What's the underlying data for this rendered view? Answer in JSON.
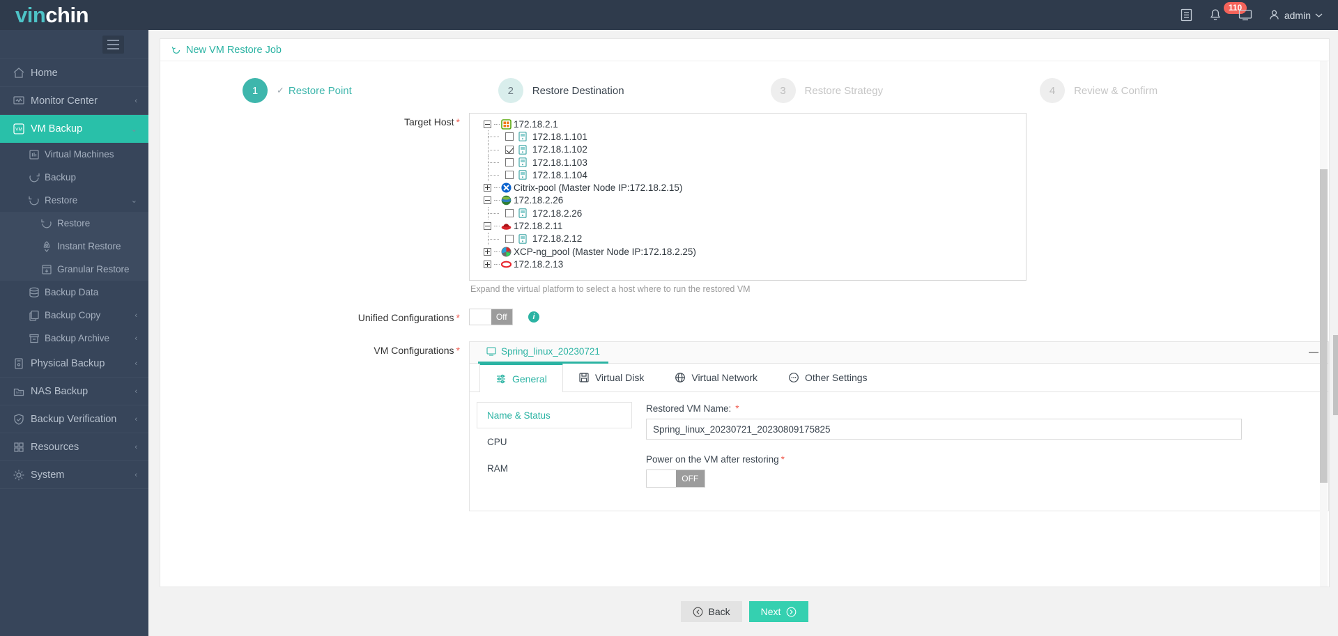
{
  "brand": {
    "part1": "vin",
    "part2": "chin"
  },
  "topbar": {
    "notifications_count": "110",
    "user_name": "admin",
    "log_icon": "list-icon",
    "bell_icon": "bell-icon",
    "monitor_icon": "monitor-icon",
    "user_icon": "user-icon",
    "caret_icon": "chevron-down-icon"
  },
  "sidebar": {
    "toggle_icon": "hamburger-icon",
    "items": [
      {
        "label": "Home",
        "icon": "home-icon",
        "level": 1,
        "active": false,
        "chevron": ""
      },
      {
        "label": "Monitor Center",
        "icon": "monitor-chart-icon",
        "level": 1,
        "active": false,
        "chevron": "‹"
      },
      {
        "label": "VM Backup",
        "icon": "vm-icon",
        "level": 1,
        "active": true,
        "chevron": "⌄"
      },
      {
        "label": "Virtual Machines",
        "icon": "machines-icon",
        "level": 2,
        "active": false,
        "chevron": ""
      },
      {
        "label": "Backup",
        "icon": "backup-icon",
        "level": 2,
        "active": false,
        "chevron": ""
      },
      {
        "label": "Restore",
        "icon": "restore-icon",
        "level": 2,
        "active": false,
        "chevron": "⌄"
      },
      {
        "label": "Restore",
        "icon": "restore-icon",
        "level": 3,
        "active": false,
        "chevron": ""
      },
      {
        "label": "Instant Restore",
        "icon": "rocket-icon",
        "level": 3,
        "active": false,
        "chevron": ""
      },
      {
        "label": "Granular Restore",
        "icon": "granular-icon",
        "level": 3,
        "active": false,
        "chevron": ""
      },
      {
        "label": "Backup Data",
        "icon": "database-icon",
        "level": 2,
        "active": false,
        "chevron": ""
      },
      {
        "label": "Backup Copy",
        "icon": "copy-icon",
        "level": 2,
        "active": false,
        "chevron": "‹"
      },
      {
        "label": "Backup Archive",
        "icon": "archive-icon",
        "level": 2,
        "active": false,
        "chevron": "‹"
      },
      {
        "label": "Physical Backup",
        "icon": "server-icon",
        "level": 1,
        "active": false,
        "chevron": "‹"
      },
      {
        "label": "NAS Backup",
        "icon": "nas-icon",
        "level": 1,
        "active": false,
        "chevron": "‹"
      },
      {
        "label": "Backup Verification",
        "icon": "shield-check-icon",
        "level": 1,
        "active": false,
        "chevron": "‹"
      },
      {
        "label": "Resources",
        "icon": "grid-icon",
        "level": 1,
        "active": false,
        "chevron": "‹"
      },
      {
        "label": "System",
        "icon": "gear-icon",
        "level": 1,
        "active": false,
        "chevron": "‹"
      }
    ]
  },
  "page": {
    "title": "New VM Restore Job",
    "title_icon": "restore-icon"
  },
  "stepper": {
    "steps": [
      {
        "num": "1",
        "label": "Restore Point",
        "state": "done",
        "check": "✓"
      },
      {
        "num": "2",
        "label": "Restore Destination",
        "state": "cur",
        "check": ""
      },
      {
        "num": "3",
        "label": "Restore Strategy",
        "state": "off",
        "check": ""
      },
      {
        "num": "4",
        "label": "Review & Confirm",
        "state": "off",
        "check": ""
      }
    ]
  },
  "form": {
    "target_host_label": "Target Host",
    "target_host_hint": "Expand the virtual platform to select a host where to run the restored VM",
    "unified_config_label": "Unified Configurations",
    "unified_config_value": "Off",
    "vm_config_label": "VM Configurations",
    "tree": [
      {
        "text": "172.18.2.1",
        "level": 1,
        "expander": "minus",
        "platform_icon": "vmware-green-icon",
        "checkbox": null
      },
      {
        "text": "172.18.1.101",
        "level": 2,
        "expander": null,
        "platform_icon": "host-icon",
        "checkbox": "unchecked"
      },
      {
        "text": "172.18.1.102",
        "level": 2,
        "expander": null,
        "platform_icon": "host-icon",
        "checkbox": "checked"
      },
      {
        "text": "172.18.1.103",
        "level": 2,
        "expander": null,
        "platform_icon": "host-icon",
        "checkbox": "unchecked"
      },
      {
        "text": "172.18.1.104",
        "level": 2,
        "expander": null,
        "platform_icon": "host-icon",
        "checkbox": "unchecked"
      },
      {
        "text": "Citrix-pool (Master Node IP:172.18.2.15)",
        "level": 1,
        "expander": "plus",
        "platform_icon": "citrix-icon",
        "checkbox": null
      },
      {
        "text": "172.18.2.26",
        "level": 1,
        "expander": "minus",
        "platform_icon": "globe-icon",
        "checkbox": null
      },
      {
        "text": "172.18.2.26",
        "level": 2,
        "expander": null,
        "platform_icon": "host-icon",
        "checkbox": "unchecked"
      },
      {
        "text": "172.18.2.11",
        "level": 1,
        "expander": "minus",
        "platform_icon": "redhat-icon",
        "checkbox": null
      },
      {
        "text": "172.18.2.12",
        "level": 2,
        "expander": null,
        "platform_icon": "host-icon",
        "checkbox": "unchecked"
      },
      {
        "text": "XCP-ng_pool (Master Node IP:172.18.2.25)",
        "level": 1,
        "expander": "plus",
        "platform_icon": "xcpng-icon",
        "checkbox": null
      },
      {
        "text": "172.18.2.13",
        "level": 1,
        "expander": "plus",
        "platform_icon": "oracle-icon",
        "checkbox": null
      }
    ]
  },
  "vmpanel": {
    "vm_tab_label": "Spring_linux_20230721",
    "vm_tab_icon": "vm-screen-icon",
    "collapse_icon": "minimize-icon",
    "tabs": [
      {
        "label": "General",
        "icon": "sliders-icon",
        "active": true
      },
      {
        "label": "Virtual Disk",
        "icon": "disk-icon",
        "active": false
      },
      {
        "label": "Virtual Network",
        "icon": "globe-icon",
        "active": false
      },
      {
        "label": "Other Settings",
        "icon": "dots-circle-icon",
        "active": false
      }
    ],
    "subnav": [
      {
        "label": "Name & Status",
        "active": true
      },
      {
        "label": "CPU",
        "active": false
      },
      {
        "label": "RAM",
        "active": false
      }
    ],
    "restored_vm_name_label": "Restored VM Name:",
    "restored_vm_name_value": "Spring_linux_20230721_20230809175825",
    "power_on_label": "Power on the VM after restoring",
    "power_on_value": "OFF"
  },
  "footer": {
    "back_label": "Back",
    "back_icon": "arrow-left-circle-icon",
    "next_label": "Next",
    "next_icon": "arrow-right-circle-icon"
  },
  "colors": {
    "accent": "#2bb3a3",
    "sidebar_active": "#29c0a9",
    "next_button": "#35d0b0",
    "badge": "#f4635a",
    "required": "#f05b4f"
  }
}
